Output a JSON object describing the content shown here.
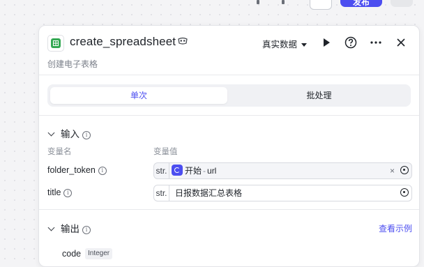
{
  "topbar": {
    "publish_label": "发布"
  },
  "node": {
    "title": "create_spreadsheet",
    "subtitle": "创建电子表格",
    "data_mode": "真实数据"
  },
  "tabs": {
    "single": "单次",
    "batch": "批处理"
  },
  "input": {
    "title": "输入",
    "col_name": "变量名",
    "col_value": "变量值",
    "params": [
      {
        "name": "folder_token",
        "type": "str.",
        "ref_node": "开始",
        "ref_sep": "-",
        "ref_var": "url"
      },
      {
        "name": "title",
        "type": "str.",
        "value": "日报数据汇总表格"
      }
    ]
  },
  "output": {
    "title": "输出",
    "example_link": "查看示例",
    "vars": [
      {
        "name": "code",
        "type": "Integer"
      }
    ]
  },
  "colors": {
    "accent": "#4c4ef0",
    "sheet_icon": "#34a853"
  }
}
